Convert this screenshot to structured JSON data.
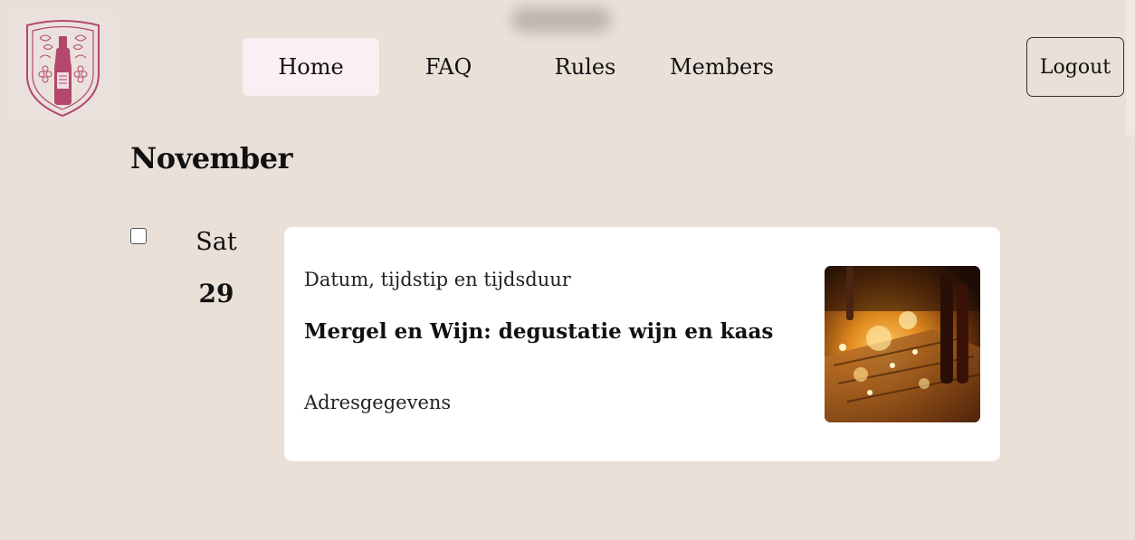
{
  "nav": {
    "items": [
      {
        "label": "Home",
        "active": true
      },
      {
        "label": "FAQ",
        "active": false
      },
      {
        "label": "Rules",
        "active": false
      },
      {
        "label": "Members",
        "active": false
      }
    ],
    "logout_label": "Logout"
  },
  "logo": {
    "icon": "wine-bottle-crest-icon",
    "color": "#b3476c"
  },
  "calendar": {
    "month": "November",
    "events": [
      {
        "day_name": "Sat",
        "day_number": "29",
        "checked": false,
        "datetime_label": "Datum, tijdstip en tijdsduur",
        "title": "Mergel en Wijn: degustatie wijn en kaas",
        "address_label": "Adresgegevens",
        "image": "wine-table-candlelight-image"
      }
    ]
  },
  "colors": {
    "background": "#e9e0d8",
    "active_nav": "#fbeff4",
    "card": "#ffffff",
    "brand": "#b3476c"
  }
}
